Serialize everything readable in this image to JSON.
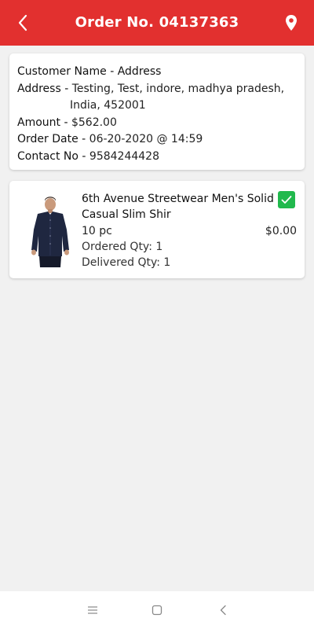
{
  "header": {
    "title": "Order No. 04137363",
    "back_icon": "chevron-left-icon",
    "location_icon": "map-pin-icon",
    "color": "#e2302f"
  },
  "order": {
    "customer_heading": "Customer Name - Address",
    "address_label": "Address - ",
    "address_line1": "Testing, Test, indore, madhya pradesh,",
    "address_line2": "India, 452001",
    "amount_label": "Amount - ",
    "amount_value": "$562.00",
    "date_label": "Order Date - ",
    "date_value": "06-20-2020 @ 14:59",
    "contact_label": "Contact No - ",
    "contact_value": "9584244428"
  },
  "items": [
    {
      "name": "6th Avenue Streetwear Men's Solid Casual Slim Shir",
      "quantity": "10 pc",
      "price": "$0.00",
      "ordered": "Ordered Qty: 1",
      "delivered": "Delivered Qty: 1",
      "checked": true,
      "check_color": "#21b94d"
    }
  ],
  "system_nav": {
    "menu_icon": "menu-icon",
    "home_icon": "home-square-icon",
    "back_icon": "back-chevron-icon"
  }
}
